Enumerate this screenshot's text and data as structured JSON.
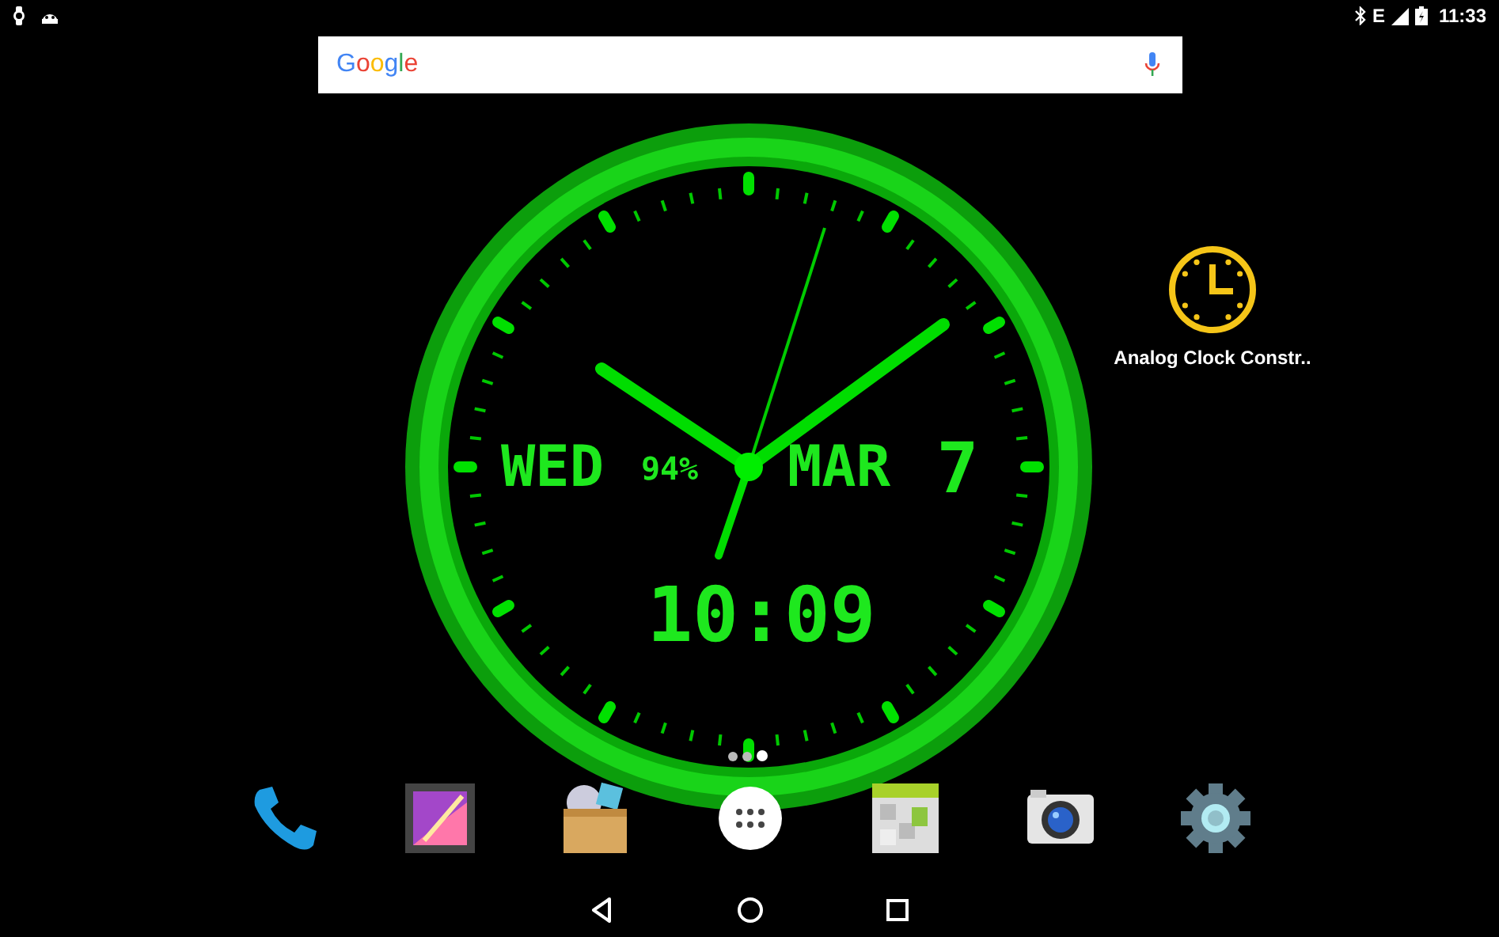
{
  "status_bar": {
    "network_type": "E",
    "time": "11:33"
  },
  "search": {
    "logo": "Google"
  },
  "clock_widget": {
    "day": "WED",
    "battery": "94%",
    "month": "MAR",
    "date": "7",
    "time": "10:09"
  },
  "shortcut": {
    "label": "Analog Clock Constr.."
  },
  "page_indicator": [
    {
      "selected": false
    },
    {
      "selected": false
    },
    {
      "selected": true
    }
  ],
  "dock": [
    {
      "kind": "phone"
    },
    {
      "kind": "gallery"
    },
    {
      "kind": "box"
    },
    {
      "kind": "apps"
    },
    {
      "kind": "grid"
    },
    {
      "kind": "camera"
    },
    {
      "kind": "gear"
    }
  ]
}
